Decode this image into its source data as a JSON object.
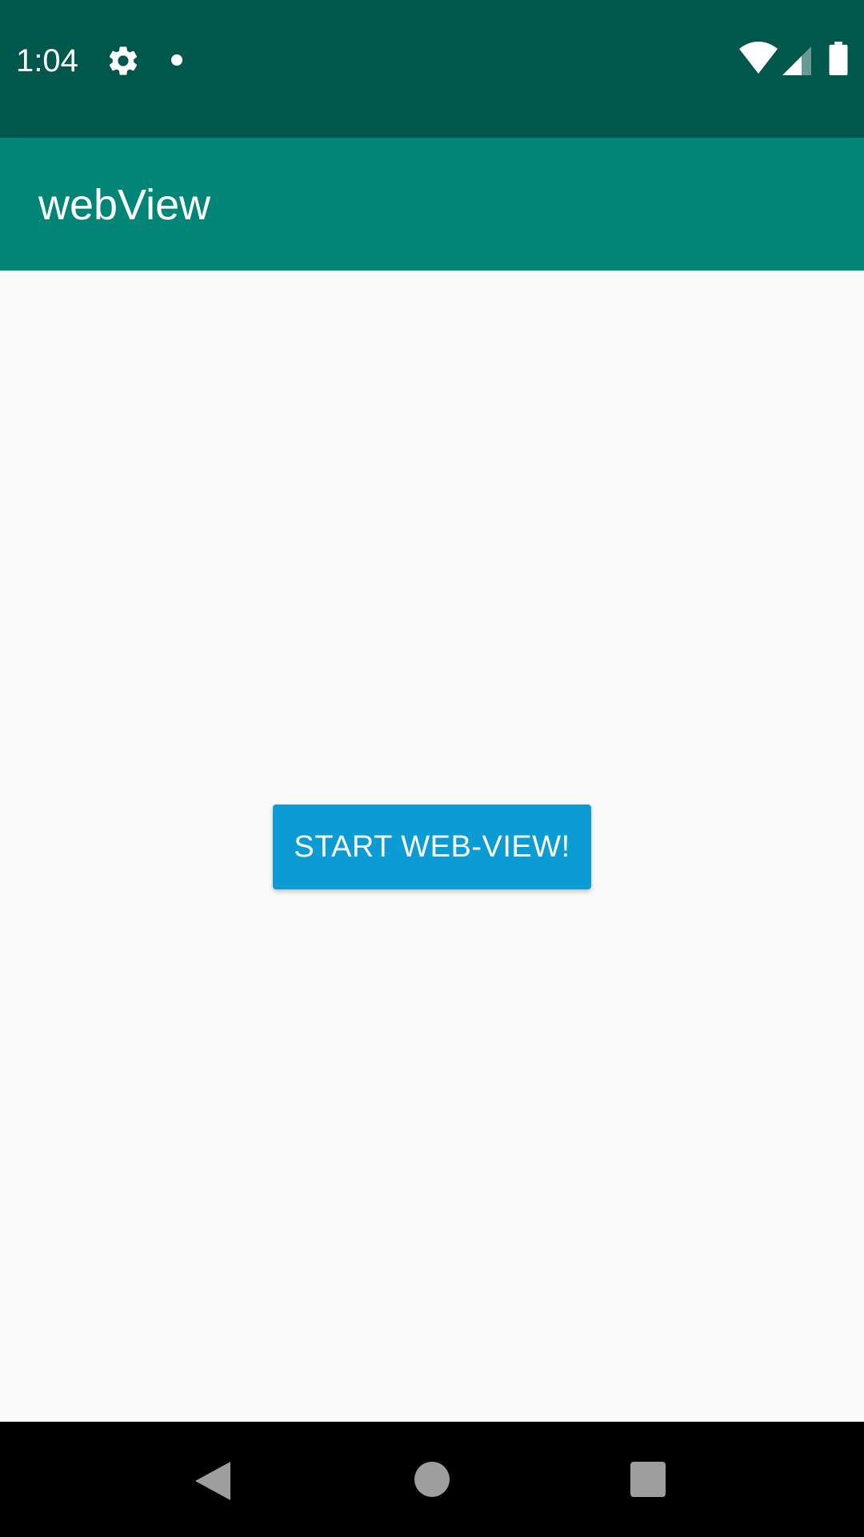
{
  "status_bar": {
    "time": "1:04",
    "icons": [
      "gear-icon",
      "notification-dot-icon",
      "wifi-icon",
      "signal-icon",
      "battery-icon"
    ],
    "background_color": "#00574b"
  },
  "app_bar": {
    "title": "webView",
    "background_color": "#008577"
  },
  "main": {
    "start_button_label": "START WEB-VIEW!",
    "button_color": "#0a9cd2"
  },
  "nav_bar": {
    "icons": [
      "back-icon",
      "home-icon",
      "recents-icon"
    ]
  }
}
